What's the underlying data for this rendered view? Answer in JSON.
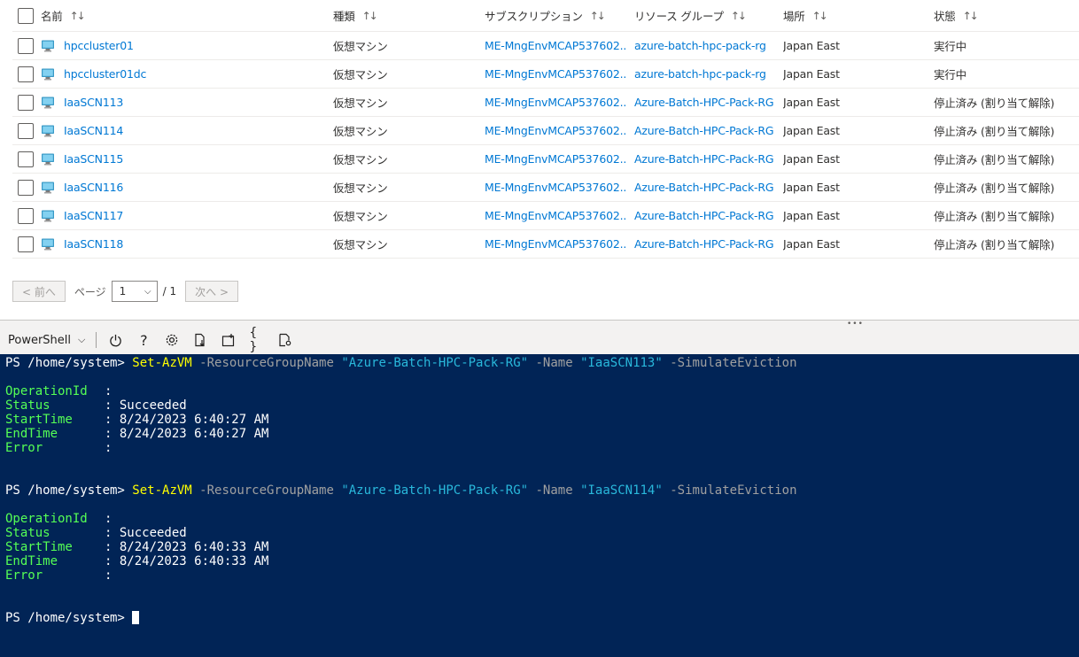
{
  "table": {
    "columns": [
      {
        "label": "名前",
        "sort": "↑↓"
      },
      {
        "label": "種類",
        "sort": "↑↓"
      },
      {
        "label": "サブスクリプション",
        "sort": "↑↓"
      },
      {
        "label": "リソース グループ",
        "sort": "↑↓"
      },
      {
        "label": "場所",
        "sort": "↑↓"
      },
      {
        "label": "状態",
        "sort": "↑↓"
      }
    ],
    "rows": [
      {
        "name": "hpccluster01",
        "type": "仮想マシン",
        "subscription": "ME-MngEnvMCAP537602...",
        "resource_group": "azure-batch-hpc-pack-rg",
        "location": "Japan East",
        "status": "実行中"
      },
      {
        "name": "hpccluster01dc",
        "type": "仮想マシン",
        "subscription": "ME-MngEnvMCAP537602...",
        "resource_group": "azure-batch-hpc-pack-rg",
        "location": "Japan East",
        "status": "実行中"
      },
      {
        "name": "IaaSCN113",
        "type": "仮想マシン",
        "subscription": "ME-MngEnvMCAP537602...",
        "resource_group": "Azure-Batch-HPC-Pack-RG",
        "location": "Japan East",
        "status": "停止済み (割り当て解除)"
      },
      {
        "name": "IaaSCN114",
        "type": "仮想マシン",
        "subscription": "ME-MngEnvMCAP537602...",
        "resource_group": "Azure-Batch-HPC-Pack-RG",
        "location": "Japan East",
        "status": "停止済み (割り当て解除)"
      },
      {
        "name": "IaaSCN115",
        "type": "仮想マシン",
        "subscription": "ME-MngEnvMCAP537602...",
        "resource_group": "Azure-Batch-HPC-Pack-RG",
        "location": "Japan East",
        "status": "停止済み (割り当て解除)"
      },
      {
        "name": "IaaSCN116",
        "type": "仮想マシン",
        "subscription": "ME-MngEnvMCAP537602...",
        "resource_group": "Azure-Batch-HPC-Pack-RG",
        "location": "Japan East",
        "status": "停止済み (割り当て解除)"
      },
      {
        "name": "IaaSCN117",
        "type": "仮想マシン",
        "subscription": "ME-MngEnvMCAP537602...",
        "resource_group": "Azure-Batch-HPC-Pack-RG",
        "location": "Japan East",
        "status": "停止済み (割り当て解除)"
      },
      {
        "name": "IaaSCN118",
        "type": "仮想マシン",
        "subscription": "ME-MngEnvMCAP537602...",
        "resource_group": "Azure-Batch-HPC-Pack-RG",
        "location": "Japan East",
        "status": "停止済み (割り当て解除)"
      }
    ]
  },
  "pager": {
    "prev_label": "< 前へ",
    "page_label": "ページ",
    "current_page": "1",
    "total": "/ 1",
    "next_label": "次へ >"
  },
  "shell": {
    "type_label": "PowerShell",
    "toolbar_icons": [
      "power-icon",
      "help-icon",
      "settings-icon",
      "upload-download-icon",
      "new-session-icon",
      "editor-icon",
      "web-preview-icon"
    ]
  },
  "terminal": {
    "prompt": "PS /home/system>",
    "blocks": [
      {
        "cmd": "Set-AzVM",
        "param1": "-ResourceGroupName",
        "rg": "\"Azure-Batch-HPC-Pack-RG\"",
        "param2": "-Name",
        "vm": "\"IaaSCN113\"",
        "param3": "-SimulateEviction",
        "fields": [
          {
            "key": "OperationId",
            "value": ""
          },
          {
            "key": "Status",
            "value": "Succeeded"
          },
          {
            "key": "StartTime",
            "value": "8/24/2023 6:40:27 AM"
          },
          {
            "key": "EndTime",
            "value": "8/24/2023 6:40:27 AM"
          },
          {
            "key": "Error",
            "value": ""
          }
        ]
      },
      {
        "cmd": "Set-AzVM",
        "param1": "-ResourceGroupName",
        "rg": "\"Azure-Batch-HPC-Pack-RG\"",
        "param2": "-Name",
        "vm": "\"IaaSCN114\"",
        "param3": "-SimulateEviction",
        "fields": [
          {
            "key": "OperationId",
            "value": ""
          },
          {
            "key": "Status",
            "value": "Succeeded"
          },
          {
            "key": "StartTime",
            "value": "8/24/2023 6:40:33 AM"
          },
          {
            "key": "EndTime",
            "value": "8/24/2023 6:40:33 AM"
          },
          {
            "key": "Error",
            "value": ""
          }
        ]
      }
    ]
  }
}
